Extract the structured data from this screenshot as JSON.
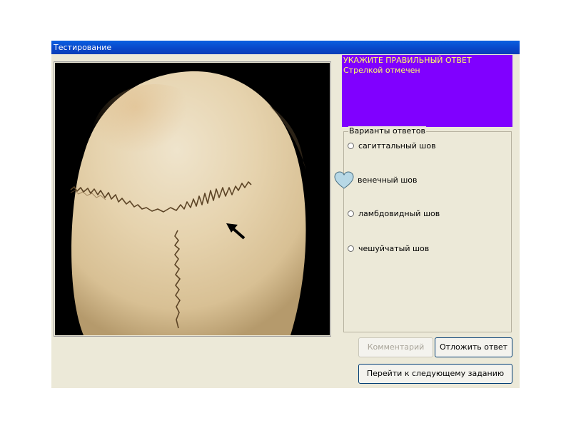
{
  "window": {
    "title": "Тестирование"
  },
  "question": {
    "prompt": "УКАЖИТЕ ПРАВИЛЬНЫЙ ОТВЕТ",
    "hint": "Стрелкой отмечен",
    "panel_color": "#8000ff",
    "text_color": "#ffff66"
  },
  "answers": {
    "legend": "Варианты ответов",
    "options": [
      {
        "label": "сагиттальный шов",
        "selected": false
      },
      {
        "label": "венечный шов",
        "selected": false,
        "cursor": "heart-icon"
      },
      {
        "label": "ламбдовидный шов",
        "selected": false
      },
      {
        "label": "чешуйчатый шов",
        "selected": false
      }
    ]
  },
  "buttons": {
    "comment": "Комментарий",
    "defer": "Отложить ответ",
    "next": "Перейти к следующему заданию"
  },
  "image": {
    "subject": "skull-top-view",
    "marker": "arrow-icon"
  }
}
